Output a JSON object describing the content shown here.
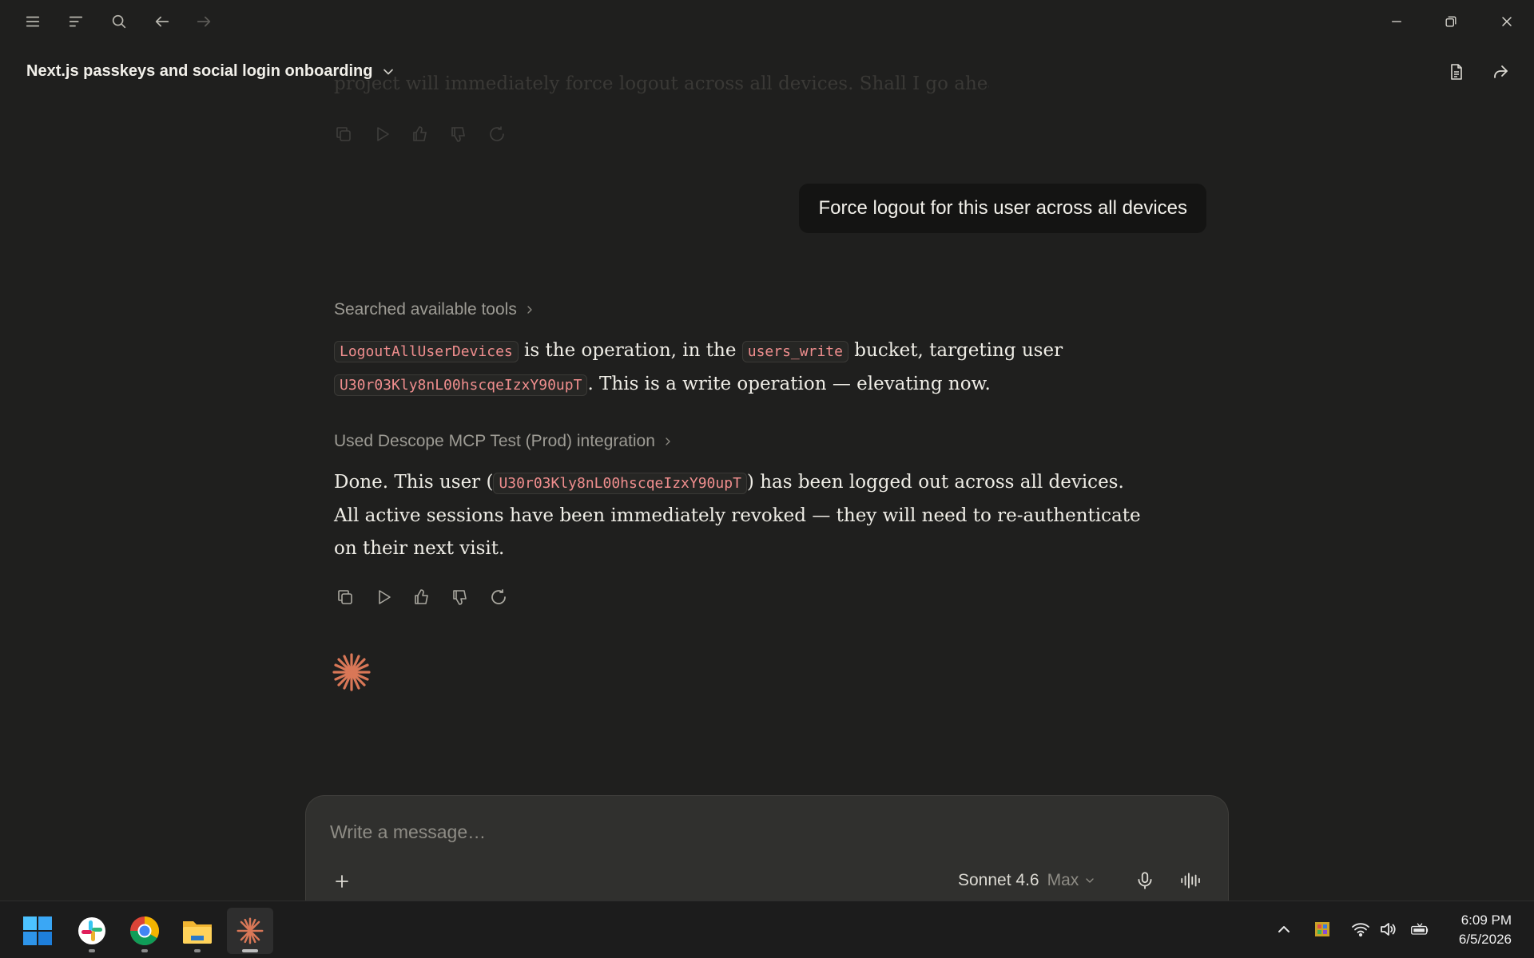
{
  "conversation": {
    "title": "Next.js passkeys and social login onboarding",
    "faded_prev_text": "project will immediately force logout across all devices. Shall I go ahead?"
  },
  "user_message": "Force logout for this user across all devices",
  "steps": {
    "searched_tools": "Searched available tools",
    "used_integration": "Used Descope MCP Test (Prod) integration"
  },
  "response1": {
    "op": "LogoutAllUserDevices",
    "t1": " is the operation, in the ",
    "bucket": "users_write",
    "t2": " bucket, targeting user ",
    "user_id": "U30r03Kly8nL00hscqeIzxY90upT",
    "t3": ". This is a write operation — elevating now."
  },
  "response2": {
    "t1": "Done. This user (",
    "user_id": "U30r03Kly8nL00hscqeIzxY90upT",
    "t2": ") has been logged out across all devices. All active sessions have been immediately revoked — they will need to re-authenticate on their next visit."
  },
  "composer": {
    "placeholder": "Write a message…",
    "model": "Sonnet 4.6",
    "mode": "Max"
  },
  "clock": {
    "time": "6:09 PM",
    "date": "6/5/2026"
  },
  "colors": {
    "background": "#1f1f1e",
    "user_bubble": "#141413",
    "code_text": "#f08e8e",
    "accent_spark": "#d97757",
    "composer": "#30302e"
  }
}
